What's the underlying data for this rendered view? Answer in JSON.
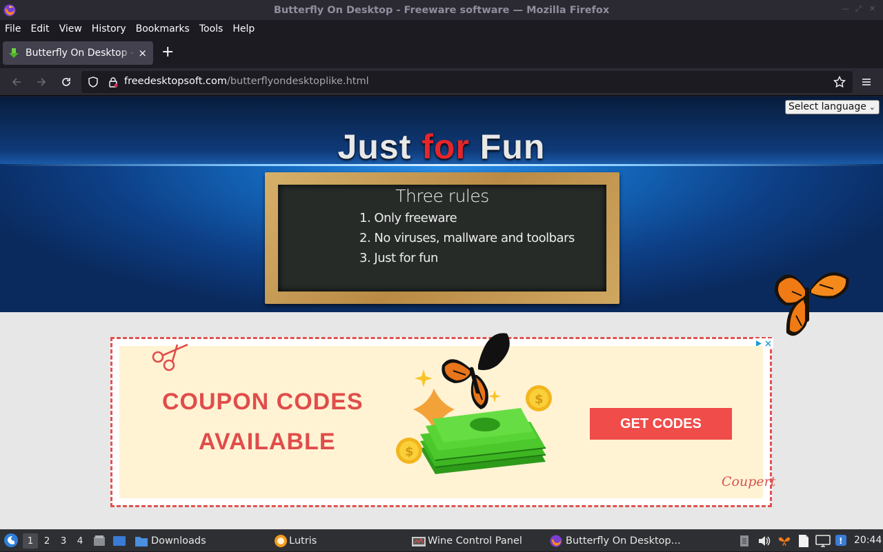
{
  "window": {
    "title": "Butterfly On Desktop - Freeware software — Mozilla Firefox"
  },
  "menu": [
    "File",
    "Edit",
    "View",
    "History",
    "Bookmarks",
    "Tools",
    "Help"
  ],
  "tab": {
    "label": "Butterfly On Desktop - Freeware software",
    "new_tab_symbol": "+",
    "close_symbol": "×"
  },
  "url": {
    "host": "freedesktopsoft.com",
    "path": "/butterflyondesktoplike.html"
  },
  "page": {
    "language_select": "Select language",
    "hero_title_1": "Just ",
    "hero_title_2": "for",
    "hero_title_3": " Fun",
    "board_title": "Three rules",
    "rules": [
      "1. Only freeware",
      "2. No viruses, mallware and toolbars",
      "3. Just for fun"
    ]
  },
  "ad": {
    "headline_1": "COUPON CODES",
    "headline_2": "AVAILABLE",
    "button": "GET CODES",
    "brand": "Coupert"
  },
  "taskbar": {
    "workspaces": [
      "1",
      "2",
      "3",
      "4"
    ],
    "active_workspace": "1",
    "items": [
      "Downloads",
      "Lutris",
      "Wine Control Panel",
      "Butterfly On Desktop..."
    ],
    "clock": "20:44"
  },
  "colors": {
    "accent_red": "#e04d4b",
    "hero_blue": "#1468bd",
    "ad_bg": "#fff3d4"
  }
}
